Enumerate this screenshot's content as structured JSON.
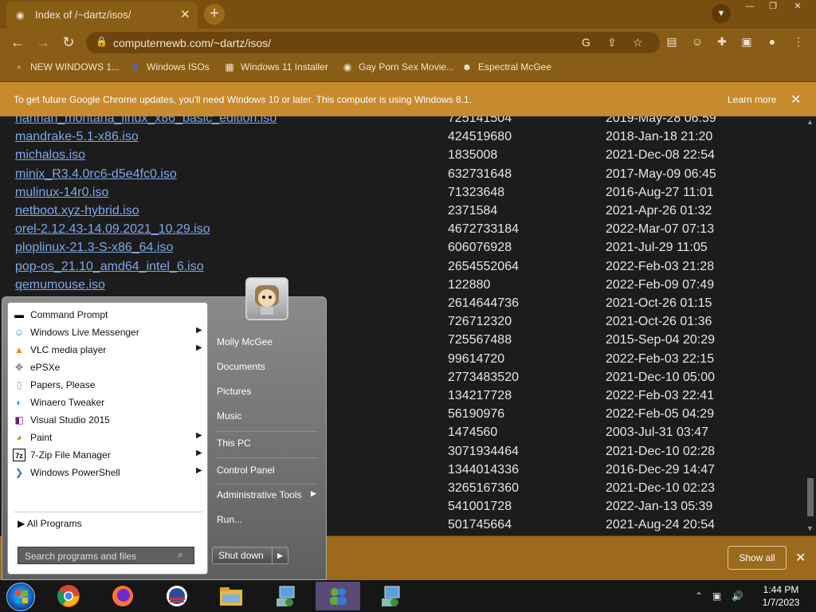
{
  "tab": {
    "title": "Index of /~dartz/isos/",
    "close": "✕"
  },
  "address": {
    "url": "computernewb.com/~dartz/isos/"
  },
  "bookmarks": [
    {
      "label": "NEW WINDOWS 1...",
      "icon": "page-icon"
    },
    {
      "label": "Windows ISOs",
      "icon": "x-logo-icon"
    },
    {
      "label": "Windows 11 Installer",
      "icon": "installer-icon"
    },
    {
      "label": "Gay Porn Sex Movie...",
      "icon": "linux-penguin-icon"
    },
    {
      "label": "Espectral McGee",
      "icon": "avatar-icon"
    }
  ],
  "infobar": {
    "message": "To get future Google Chrome updates, you'll need Windows 10 or later. This computer is using Windows 8.1.",
    "learn_more": "Learn more"
  },
  "files": [
    {
      "name": "hannah_montana_linux_x86_basic_edition.iso",
      "size": "725141504",
      "date": "2019-May-28 06:59"
    },
    {
      "name": "mandrake-5.1-x86.iso",
      "size": "424519680",
      "date": "2018-Jan-18 21:20"
    },
    {
      "name": "michalos.iso",
      "size": "1835008",
      "date": "2021-Dec-08 22:54"
    },
    {
      "name": "minix_R3.4.0rc6-d5e4fc0.iso",
      "size": "632731648",
      "date": "2017-May-09 06:45"
    },
    {
      "name": "mulinux-14r0.iso",
      "size": "71323648",
      "date": "2016-Aug-27 11:01"
    },
    {
      "name": "netboot.xyz-hybrid.iso",
      "size": "2371584",
      "date": "2021-Apr-26 01:32"
    },
    {
      "name": "orel-2.12.43-14.09.2021_10.29.iso",
      "size": "4672733184",
      "date": "2022-Mar-07 07:13"
    },
    {
      "name": "ploplinux-21.3-S-x86_64.iso",
      "size": "606076928",
      "date": "2021-Jul-29 11:05"
    },
    {
      "name": "pop-os_21.10_amd64_intel_6.iso",
      "size": "2654552064",
      "date": "2022-Feb-03 21:28"
    },
    {
      "name": "qemumouse.iso",
      "size": "122880",
      "date": "2022-Feb-09 07:49"
    },
    {
      "name": "",
      "size": "2614644736",
      "date": "2021-Oct-26 01:15"
    },
    {
      "name": "",
      "size": "726712320",
      "date": "2021-Oct-26 01:36"
    },
    {
      "name": "",
      "size": "725567488",
      "date": "2015-Sep-04 20:29"
    },
    {
      "name": "",
      "size": "99614720",
      "date": "2022-Feb-03 22:15"
    },
    {
      "name": "",
      "size": "2773483520",
      "date": "2021-Dec-10 05:00"
    },
    {
      "name": "",
      "size": "134217728",
      "date": "2022-Feb-03 22:41"
    },
    {
      "name": "",
      "size": "56190976",
      "date": "2022-Feb-05 04:29"
    },
    {
      "name": "",
      "size": "1474560",
      "date": "2003-Jul-31 03:47"
    },
    {
      "name": "",
      "size": "3071934464",
      "date": "2021-Dec-10 02:28"
    },
    {
      "name": "",
      "size": "1344014336",
      "date": "2016-Dec-29 14:47"
    },
    {
      "name": "",
      "size": "3265167360",
      "date": "2021-Dec-10 02:23"
    },
    {
      "name": "",
      "size": "541001728",
      "date": "2022-Jan-13 05:39"
    },
    {
      "name": "",
      "size": "501745664",
      "date": "2021-Aug-24 20:54"
    }
  ],
  "shelf": {
    "show_all": "Show all"
  },
  "start_menu": {
    "programs": [
      {
        "label": "Command Prompt",
        "icon": "cmd-icon",
        "submenu": false
      },
      {
        "label": "Windows Live Messenger",
        "icon": "messenger-icon",
        "submenu": true
      },
      {
        "label": "VLC media player",
        "icon": "vlc-cone-icon",
        "submenu": true
      },
      {
        "label": "ePSXe",
        "icon": "gamepad-icon",
        "submenu": false
      },
      {
        "label": "Papers, Please",
        "icon": "document-icon",
        "submenu": false
      },
      {
        "label": "Winaero Tweaker",
        "icon": "tweaker-icon",
        "submenu": false
      },
      {
        "label": "Visual Studio 2015",
        "icon": "visual-studio-icon",
        "submenu": false
      },
      {
        "label": "Paint",
        "icon": "paint-palette-icon",
        "submenu": true
      },
      {
        "label": "7-Zip File Manager",
        "icon": "7zip-icon",
        "submenu": true
      },
      {
        "label": "Windows PowerShell",
        "icon": "powershell-icon",
        "submenu": true
      }
    ],
    "all_programs": "All Programs",
    "search_placeholder": "Search programs and files",
    "right": [
      {
        "label": "Molly McGee",
        "key": "user"
      },
      {
        "label": "Documents",
        "key": "documents"
      },
      {
        "label": "Pictures",
        "key": "pictures"
      },
      {
        "label": "Music",
        "key": "music"
      },
      {
        "label": "This PC",
        "key": "this-pc"
      },
      {
        "label": "Control Panel",
        "key": "control-panel"
      },
      {
        "label": "Administrative Tools",
        "key": "admin-tools"
      },
      {
        "label": "Run...",
        "key": "run"
      }
    ],
    "shutdown": "Shut down"
  },
  "clock": {
    "time": "1:44 PM",
    "date": "1/7/2023"
  },
  "colors": {
    "chrome_frame": "#7a4e0f",
    "toolbar": "#8a5d16",
    "infobar": "#c78a2d",
    "link": "#7da8e8",
    "page_bg": "#1c1c1c"
  }
}
